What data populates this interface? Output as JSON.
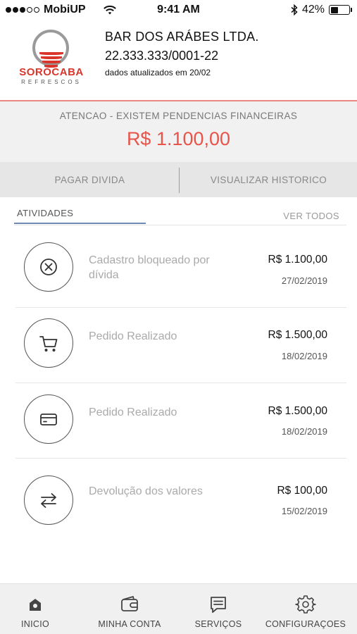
{
  "status_bar": {
    "carrier": "MobiUP",
    "time": "9:41 AM",
    "battery": "42%",
    "battery_level": 0.42,
    "icons": [
      "signal-dots-icon",
      "wifi-icon",
      "bluetooth-icon",
      "battery-icon"
    ]
  },
  "company": {
    "logo_name": "SOROCABA",
    "logo_sub": "REFRESCOS",
    "name": "BAR DOS ARÁBES LTDA.",
    "id": "22.333.333/0001-22",
    "updated": "dados atualizados em 20/02"
  },
  "alert": {
    "title": "ATENCAO - EXISTEM PENDENCIAS FINANCEIRAS",
    "amount": "R$ 1.100,00",
    "color": "#e8534a"
  },
  "actions": {
    "pay": "PAGAR DIVIDA",
    "history": "VISUALIZAR HISTORICO"
  },
  "tabs": {
    "activities": "ATIVIDADES",
    "see_all": "VER TODOS"
  },
  "activities": [
    {
      "icon": "close-circle-icon",
      "description": "Cadastro bloqueado por dívida",
      "value": "R$ 1.100,00",
      "date": "27/02/2019"
    },
    {
      "icon": "cart-icon",
      "description": "Pedido Realizado",
      "value": "R$ 1.500,00",
      "date": "18/02/2019"
    },
    {
      "icon": "card-icon",
      "description": "Pedido Realizado",
      "value": "R$ 1.500,00",
      "date": "18/02/2019"
    },
    {
      "icon": "transfer-icon",
      "description": "Devolução dos valores",
      "value": "R$ 100,00",
      "date": "15/02/2019"
    }
  ],
  "bottom_nav": [
    {
      "icon": "home-icon",
      "label": "INICIO"
    },
    {
      "icon": "wallet-icon",
      "label": "MINHA CONTA"
    },
    {
      "icon": "chat-icon",
      "label": "SERVIÇOS"
    },
    {
      "icon": "gear-icon",
      "label": "CONFIGURAÇOES"
    }
  ],
  "colors": {
    "accent_red": "#e8534a",
    "header_line": "#e98a82",
    "tab_indicator": "#6f8ab2"
  }
}
